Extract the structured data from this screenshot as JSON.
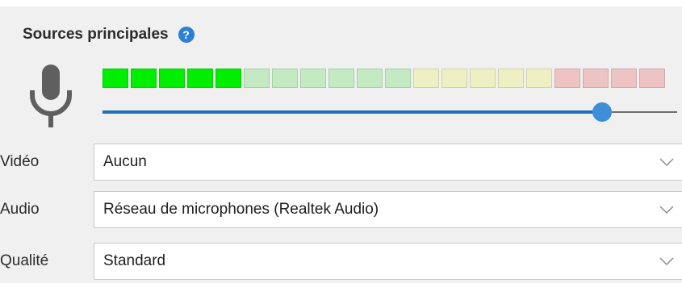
{
  "section": {
    "title": "Sources principales",
    "help_icon": "?"
  },
  "audio_meter": {
    "total_segments": 20,
    "active_segments": 5,
    "colors": {
      "active_green": "#00ee00",
      "inactive_green": "#c3eac3",
      "inactive_yellow": "#eef0c3",
      "inactive_red": "#eec3c3"
    },
    "zones": {
      "green_count": 11,
      "yellow_count": 5,
      "red_count": 4
    }
  },
  "volume_slider": {
    "value_fraction": 0.87,
    "accent": "#1f6fb8",
    "thumb_color": "#3d8fd8"
  },
  "fields": {
    "video": {
      "label": "Vidéo",
      "value": "Aucun"
    },
    "audio": {
      "label": "Audio",
      "value": "Réseau de microphones (Realtek Audio)"
    },
    "quality": {
      "label": "Qualité",
      "value": "Standard"
    }
  },
  "icons": {
    "microphone": "microphone-icon",
    "dropdown": "chevron-down-icon"
  }
}
